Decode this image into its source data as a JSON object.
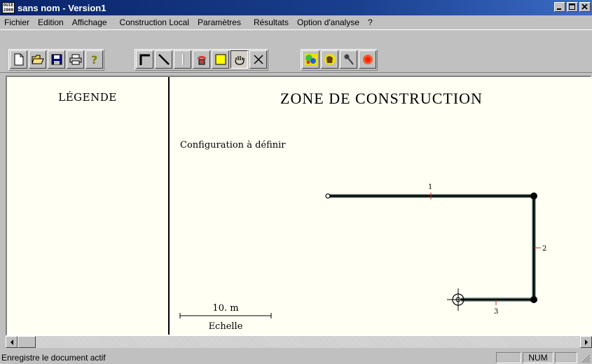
{
  "window": {
    "title": "sans nom - Version1",
    "app_icon_text": [
      "OUIE",
      "2000"
    ],
    "buttons": {
      "minimize": "_",
      "maximize": "□",
      "close": "×"
    }
  },
  "menu": [
    {
      "label": "Fichier",
      "id": "fichier"
    },
    {
      "label": "Edition",
      "id": "edition"
    },
    {
      "label": "Affichage",
      "id": "affichage"
    },
    {
      "label": "Construction Local",
      "id": "construction-local"
    },
    {
      "label": "Paramètres",
      "id": "parametres"
    },
    {
      "label": "Résultats",
      "id": "resultats"
    },
    {
      "label": "Option d'analyse",
      "id": "option-analyse"
    },
    {
      "label": "?",
      "id": "help"
    }
  ],
  "toolbar": {
    "file_tools": [
      "new-file-icon",
      "open-folder-icon",
      "save-disk-icon",
      "print-icon",
      "help-question-icon"
    ],
    "construction_tools": [
      "wall-corner-icon",
      "diagonal-line-icon",
      "vertical-line-icon",
      "speaker-source-icon",
      "yellow-square-icon",
      "hand-pan-icon",
      "delete-cross-icon"
    ],
    "analysis_tools": [
      "color-map-icon",
      "listener-head-icon",
      "microphone-icon",
      "red-target-icon"
    ],
    "pressed_tool": "hand-pan-icon"
  },
  "legend": {
    "title": "LÉGENDE"
  },
  "zone": {
    "title": "ZONE DE CONSTRUCTION",
    "config_text": "Configuration à définir",
    "segment_labels": [
      "1",
      "2",
      "3"
    ],
    "scale": {
      "value": "10. m",
      "label": "Echelle"
    }
  },
  "statusbar": {
    "message": "Enregistre le document actif",
    "num_indicator": "NUM"
  },
  "colors": {
    "titlebar": "#0a246a",
    "canvas_bg": "#fffff3",
    "wall_shadow": "#8fa89c"
  }
}
